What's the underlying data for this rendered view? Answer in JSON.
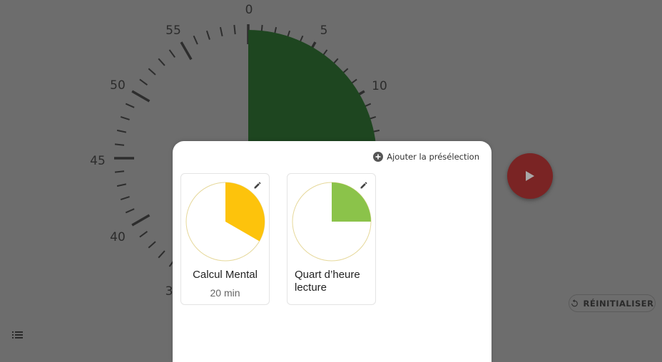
{
  "clock": {
    "numbers": [
      "0",
      "5",
      "10",
      "45",
      "50",
      "55",
      "40",
      "3"
    ],
    "elapsed_minutes": 15,
    "fill_color": "#1e4620",
    "tick_color": "#2d2d2d"
  },
  "play": {
    "icon": "play-icon",
    "color": "#7a2424"
  },
  "reset": {
    "label": "RÉINITIALISER",
    "icon": "reset-icon"
  },
  "menu": {
    "icon": "list-icon"
  },
  "presets_sheet": {
    "add_label": "Ajouter la présélection",
    "add_icon": "plus-circle-icon",
    "cards": [
      {
        "title": "Calcul Mental",
        "subtitle": "20 min",
        "minutes": 20,
        "color": "#fdc30c",
        "edit_icon": "pencil-icon"
      },
      {
        "title": "Quart d’heure lecture",
        "subtitle": "",
        "minutes": 15,
        "color": "#8bc34a",
        "edit_icon": "pencil-icon"
      }
    ]
  }
}
